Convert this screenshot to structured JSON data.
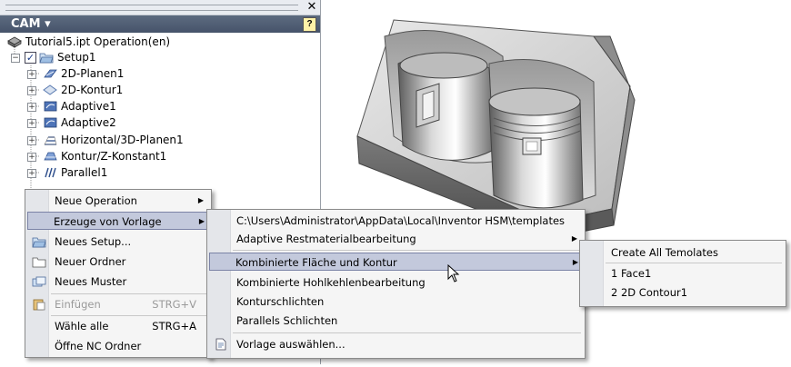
{
  "panel": {
    "title": "CAM ▾",
    "help_label": "?",
    "close_label": "✕",
    "root": "Tutorial5.ipt Operation(en)",
    "setup": "Setup1",
    "operations": [
      "2D-Planen1",
      "2D-Kontur1",
      "Adaptive1",
      "Adaptive2",
      "Horizontal/3D-Planen1",
      "Kontur/Z-Konstant1",
      "Parallel1"
    ]
  },
  "menu1": {
    "neue_operation": "Neue Operation",
    "erzeuge_vorlage": "Erzeuge von Vorlage",
    "neues_setup": "Neues Setup...",
    "neuer_ordner": "Neuer Ordner",
    "neues_muster": "Neues Muster",
    "einfuegen": "Einfügen",
    "einfuegen_sc": "STRG+V",
    "waehle_alle": "Wähle alle",
    "waehle_alle_sc": "STRG+A",
    "oeffne_nc": "Öffne NC Ordner"
  },
  "menu2": {
    "path": "C:\\Users\\Administrator\\AppData\\Local\\Inventor HSM\\templates",
    "adaptive": "Adaptive Restmaterialbearbeitung",
    "kombinierte": "Kombinierte Fläche und Kontur",
    "hohlkehlen": "Kombinierte Hohlkehlenbearbeitung",
    "konturschlichten": "Konturschlichten",
    "parallels": "Parallels Schlichten",
    "vorlage": "Vorlage auswählen..."
  },
  "menu3": {
    "create_all": "Create All Temolates",
    "face1": "1 Face1",
    "contour1": "2 2D Contour1"
  },
  "colors": {
    "header": "#4f5c72",
    "highlight": "#c3c9dc",
    "menu_bg": "#f5f5f5"
  }
}
